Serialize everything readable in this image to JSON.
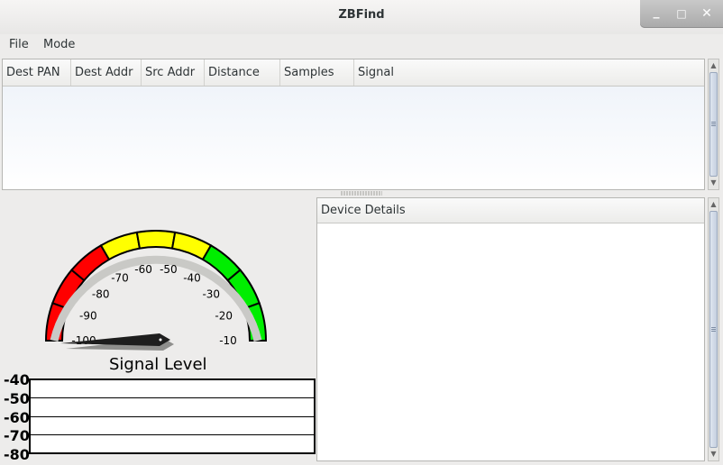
{
  "window": {
    "title": "ZBFind",
    "min": "_",
    "max": "□",
    "close": "✕"
  },
  "menu": {
    "items": [
      "File",
      "Mode"
    ]
  },
  "table": {
    "columns": [
      "Dest PAN",
      "Dest Addr",
      "Src Addr",
      "Distance",
      "Samples",
      "Signal"
    ],
    "rows": []
  },
  "details": {
    "title": "Device Details"
  },
  "gauge": {
    "title": "Signal Level",
    "value": -100,
    "ticks": [
      "-100",
      "-90",
      "-80",
      "-70",
      "-60",
      "-50",
      "-40",
      "-30",
      "-20",
      "-10"
    ],
    "zone_colors": {
      "red": "#ff0000",
      "yellow": "#ffff00",
      "green": "#00ee00"
    }
  },
  "graph": {
    "y_labels": [
      "-40",
      "-50",
      "-60",
      "-70",
      "-80"
    ]
  }
}
